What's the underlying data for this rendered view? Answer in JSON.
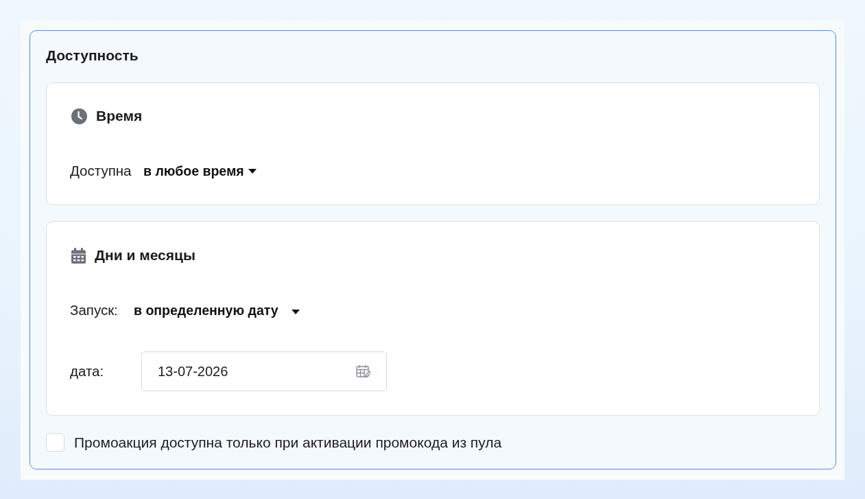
{
  "section": {
    "title": "Доступность"
  },
  "cards": [
    {
      "kind": "time",
      "title": "Время",
      "fields": [
        {
          "kind": "dropdown",
          "label": "Доступна",
          "value": "в любое время"
        }
      ]
    },
    {
      "kind": "days",
      "title": "Дни и месяцы",
      "fields": [
        {
          "kind": "dropdown",
          "label": "Запуск:",
          "value": "в определенную дату"
        },
        {
          "kind": "date",
          "label": "дата:",
          "value": "13-07-2026"
        }
      ]
    }
  ],
  "promo_checkbox": {
    "label": "Промоакция доступна только при активации промокода из пула",
    "checked": false
  }
}
